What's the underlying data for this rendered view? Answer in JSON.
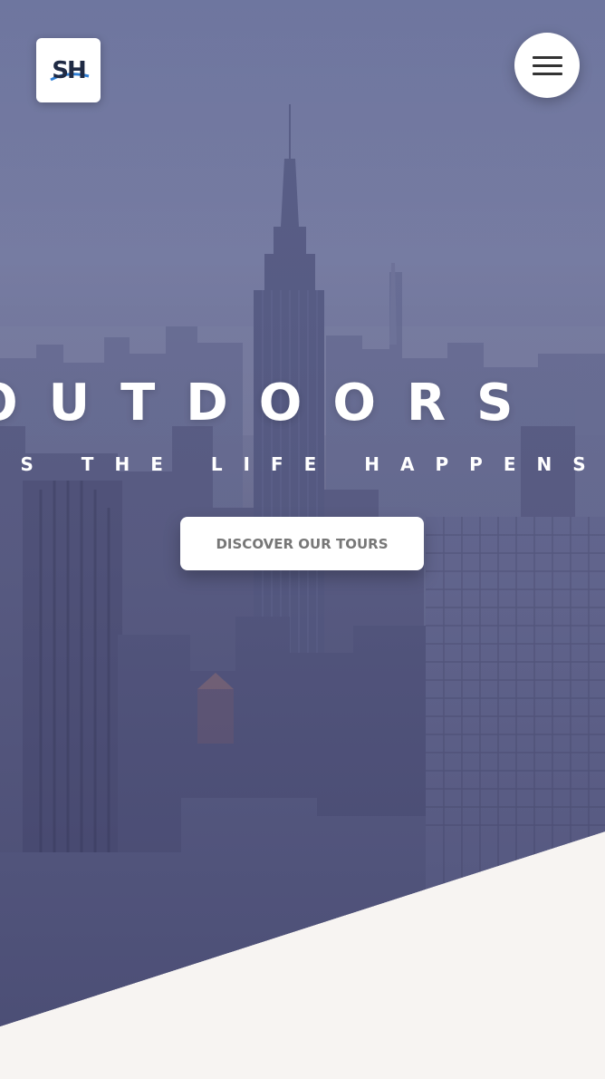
{
  "brand": {
    "logo_text": "SH",
    "logo_icon": "sh-logo-icon"
  },
  "header": {
    "menu_icon": "hamburger-menu-icon"
  },
  "hero": {
    "headline": "OUTDOORS",
    "subline": "IS THE LIFE HAPPENS",
    "cta_label": "DISCOVER OUR TOURS"
  },
  "colors": {
    "hero_tint": "#5d6396",
    "footer_bg": "#f7f4f2",
    "cta_text": "#777777",
    "white": "#ffffff"
  }
}
